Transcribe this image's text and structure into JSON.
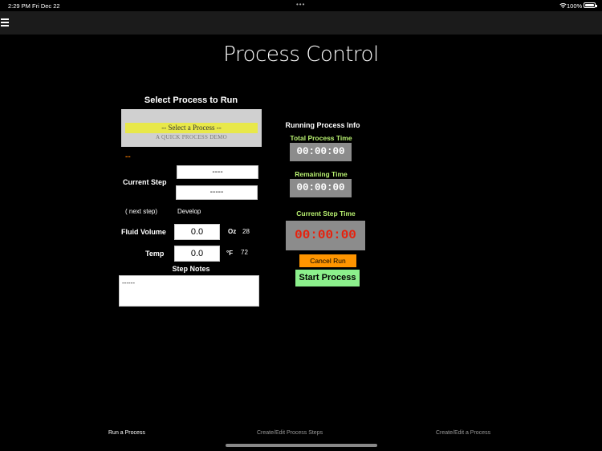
{
  "status_bar": {
    "time": "2:29 PM",
    "date": "Fri Dec 22",
    "dots": "•••",
    "battery_pct": "100%"
  },
  "page": {
    "title": "Process Control"
  },
  "process_select": {
    "title": "Select Process to Run",
    "picker_selected": "-- Select a Process --",
    "picker_next": "A QUICK  PROCESS DEMO",
    "indicator": "--"
  },
  "current_step": {
    "label": "Current Step",
    "name": "----",
    "sub": "-----",
    "next_step_label": "( next step)",
    "next_step_value": "Develop"
  },
  "fluid": {
    "label": "Fluid Volume",
    "value": "0.0",
    "unit": "Oz",
    "unit_value": "28"
  },
  "temp": {
    "label": "Temp",
    "value": "0.0",
    "unit": "°F",
    "unit_value": "72"
  },
  "notes": {
    "title": "Step Notes",
    "text": "------"
  },
  "running_info": {
    "title": "Running Process Info",
    "total_label": "Total Process Time",
    "total_time": "00:00:00",
    "remaining_label": "Remaining Time",
    "remaining_time": "00:00:00",
    "step_label": "Current Step Time",
    "step_time": "00:00:00",
    "step_time_color": "#e8200c"
  },
  "buttons": {
    "cancel": "Cancel Run",
    "start": "Start Process",
    "cancel_color": "#ff9500",
    "start_color": "#8cf08c"
  },
  "tabs": [
    {
      "label": "Run a Process",
      "active": true
    },
    {
      "label": "Create/Edit Process Steps",
      "active": false
    },
    {
      "label": "Create/Edit a Process",
      "active": false
    }
  ]
}
